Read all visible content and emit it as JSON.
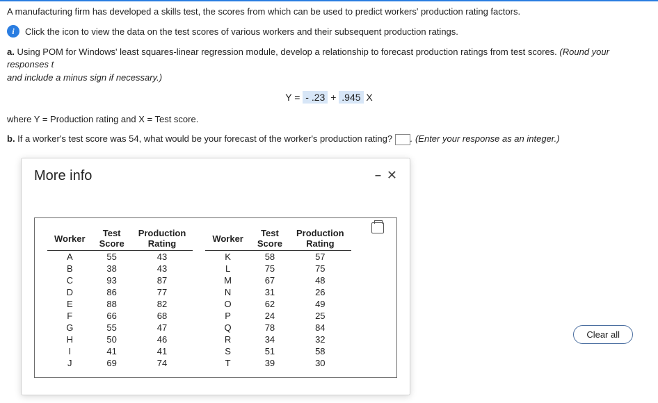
{
  "intro": "A manufacturing firm has developed a skills test, the scores from which can be used to predict workers' production rating factors.",
  "info_icon": "i",
  "info_text": "Click the icon to view the data on the test scores of various workers and their subsequent production ratings.",
  "part_a_label": "a.",
  "part_a_text": " Using POM for Windows' least squares-linear regression module, develop a relationship to forecast production ratings from test scores. ",
  "round_hint": "(Round your responses t",
  "round_hint2": "and include a minus sign if necessary.)",
  "eq_prefix": "Y = ",
  "eq_intercept": "- .23",
  "eq_plus": " + ",
  "eq_slope": ".945",
  "eq_suffix": " X",
  "where_text": "where Y = Production rating and X = Test score.",
  "part_b_label": "b.",
  "part_b_text": " If a worker's test score was 54, what would be your forecast of the worker's production rating? ",
  "part_b_hint": ". (Enter your response as an integer.)",
  "modal": {
    "title": "More info",
    "dash": "–",
    "close": "✕"
  },
  "headers": {
    "worker": "Worker",
    "score_l1": "Test",
    "score_l2": "Score",
    "rating_l1": "Production",
    "rating_l2": "Rating"
  },
  "left": [
    {
      "w": "A",
      "s": "55",
      "r": "43"
    },
    {
      "w": "B",
      "s": "38",
      "r": "43"
    },
    {
      "w": "C",
      "s": "93",
      "r": "87"
    },
    {
      "w": "D",
      "s": "86",
      "r": "77"
    },
    {
      "w": "E",
      "s": "88",
      "r": "82"
    },
    {
      "w": "F",
      "s": "66",
      "r": "68"
    },
    {
      "w": "G",
      "s": "55",
      "r": "47"
    },
    {
      "w": "H",
      "s": "50",
      "r": "46"
    },
    {
      "w": "I",
      "s": "41",
      "r": "41"
    },
    {
      "w": "J",
      "s": "69",
      "r": "74"
    }
  ],
  "right": [
    {
      "w": "K",
      "s": "58",
      "r": "57"
    },
    {
      "w": "L",
      "s": "75",
      "r": "75"
    },
    {
      "w": "M",
      "s": "67",
      "r": "48"
    },
    {
      "w": "N",
      "s": "31",
      "r": "26"
    },
    {
      "w": "O",
      "s": "62",
      "r": "49"
    },
    {
      "w": "P",
      "s": "24",
      "r": "25"
    },
    {
      "w": "Q",
      "s": "78",
      "r": "84"
    },
    {
      "w": "R",
      "s": "34",
      "r": "32"
    },
    {
      "w": "S",
      "s": "51",
      "r": "58"
    },
    {
      "w": "T",
      "s": "39",
      "r": "30"
    }
  ],
  "clear_all": "Clear all",
  "chart_data": {
    "type": "table",
    "columns": [
      "Worker",
      "Test Score",
      "Production Rating"
    ],
    "rows": [
      [
        "A",
        55,
        43
      ],
      [
        "B",
        38,
        43
      ],
      [
        "C",
        93,
        87
      ],
      [
        "D",
        86,
        77
      ],
      [
        "E",
        88,
        82
      ],
      [
        "F",
        66,
        68
      ],
      [
        "G",
        55,
        47
      ],
      [
        "H",
        50,
        46
      ],
      [
        "I",
        41,
        41
      ],
      [
        "J",
        69,
        74
      ],
      [
        "K",
        58,
        57
      ],
      [
        "L",
        75,
        75
      ],
      [
        "M",
        67,
        48
      ],
      [
        "N",
        31,
        26
      ],
      [
        "O",
        62,
        49
      ],
      [
        "P",
        24,
        25
      ],
      [
        "Q",
        78,
        84
      ],
      [
        "R",
        34,
        32
      ],
      [
        "S",
        51,
        58
      ],
      [
        "T",
        39,
        30
      ]
    ],
    "regression": {
      "intercept": -0.23,
      "slope": 0.945,
      "equation": "Y = -.23 + .945 X"
    }
  }
}
